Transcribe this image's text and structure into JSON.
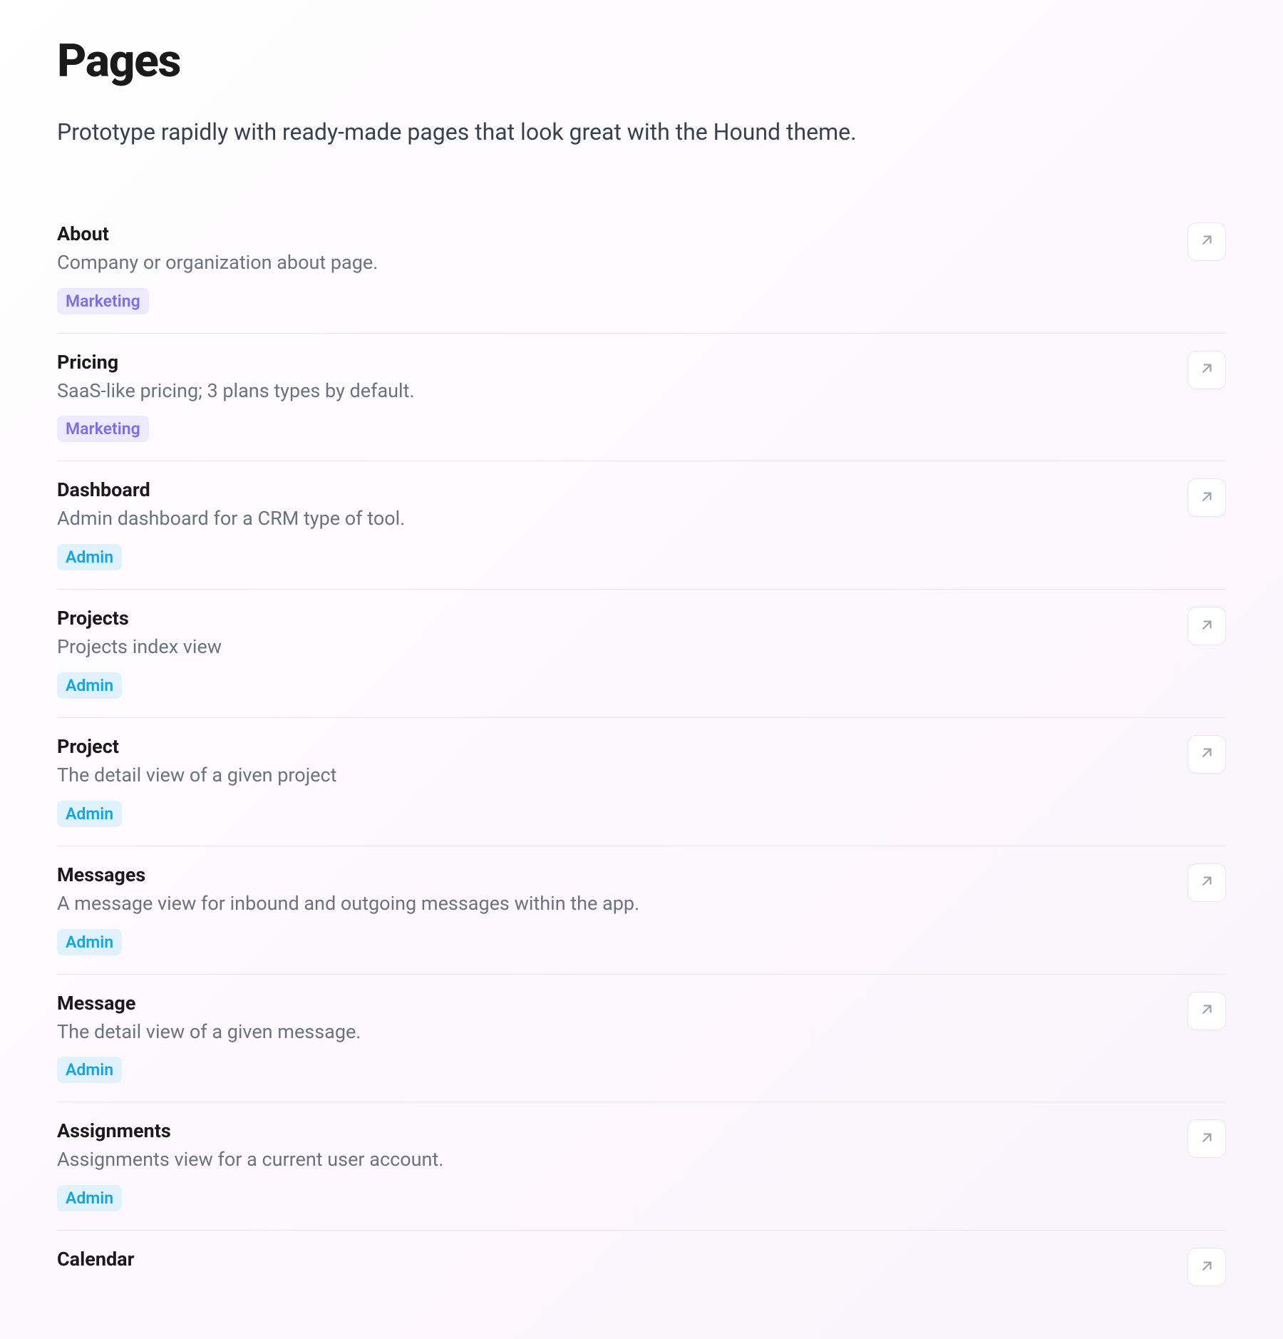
{
  "header": {
    "title": "Pages",
    "subtitle": "Prototype rapidly with ready-made pages that look great with the Hound theme."
  },
  "items": [
    {
      "title": "About",
      "description": "Company or organization about page.",
      "tag": "Marketing",
      "tagType": "marketing"
    },
    {
      "title": "Pricing",
      "description": "SaaS-like pricing; 3 plans types by default.",
      "tag": "Marketing",
      "tagType": "marketing"
    },
    {
      "title": "Dashboard",
      "description": "Admin dashboard for a CRM type of tool.",
      "tag": "Admin",
      "tagType": "admin"
    },
    {
      "title": "Projects",
      "description": "Projects index view",
      "tag": "Admin",
      "tagType": "admin"
    },
    {
      "title": "Project",
      "description": "The detail view of a given project",
      "tag": "Admin",
      "tagType": "admin"
    },
    {
      "title": "Messages",
      "description": "A message view for inbound and outgoing messages within the app.",
      "tag": "Admin",
      "tagType": "admin"
    },
    {
      "title": "Message",
      "description": "The detail view of a given message.",
      "tag": "Admin",
      "tagType": "admin"
    },
    {
      "title": "Assignments",
      "description": "Assignments view for a current user account.",
      "tag": "Admin",
      "tagType": "admin"
    },
    {
      "title": "Calendar",
      "description": "",
      "tag": "",
      "tagType": ""
    }
  ]
}
